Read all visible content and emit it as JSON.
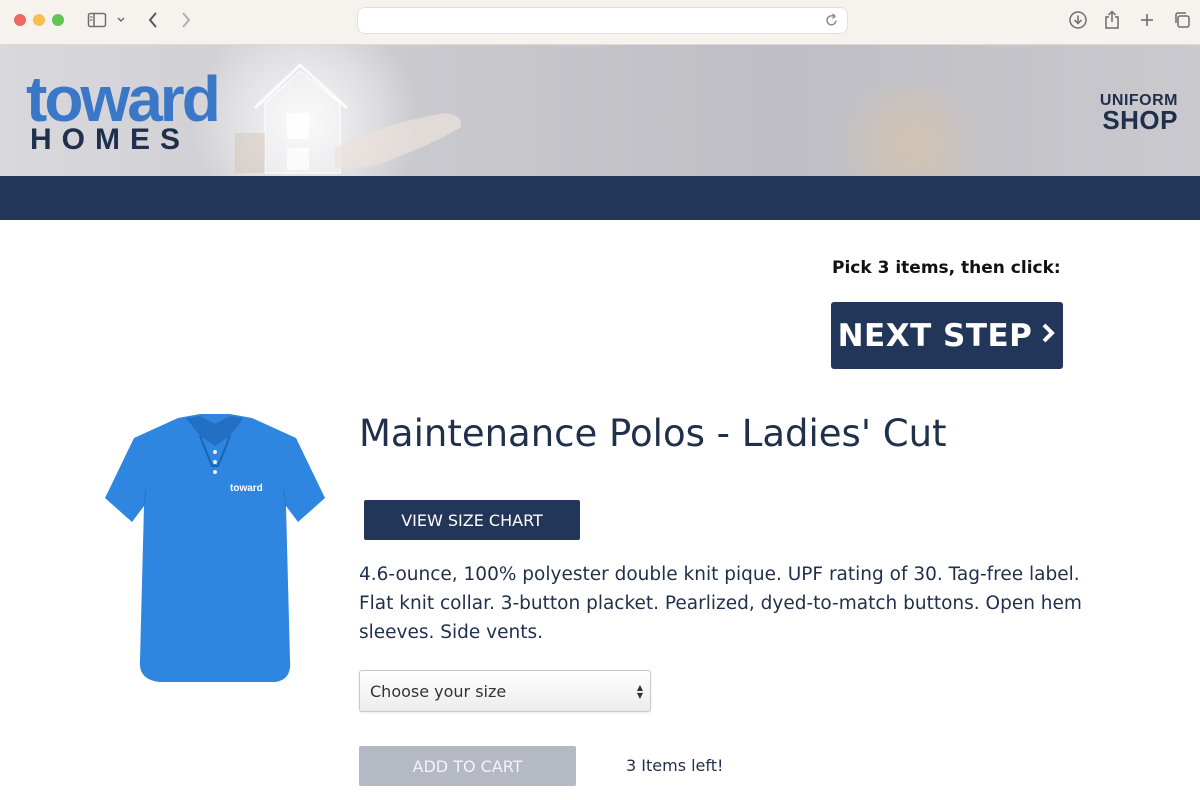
{
  "browser": {
    "toolbar_icons": [
      "sidebar-icon",
      "chevron-down-icon",
      "back-icon",
      "forward-icon",
      "reload-icon",
      "download-icon",
      "share-icon",
      "new-tab-icon",
      "tabs-overview-icon"
    ],
    "address_value": ""
  },
  "header": {
    "logo_top": "toward",
    "logo_bottom": "HOMES",
    "shop_line1": "UNIFORM",
    "shop_line2": "SHOP"
  },
  "cta": {
    "instruction": "Pick 3 items, then click:",
    "next_label": "NEXT STEP"
  },
  "product": {
    "title": "Maintenance Polos - Ladies' Cut",
    "size_chart_label": "VIEW SIZE CHART",
    "description": "4.6-ounce, 100% polyester double knit pique. UPF rating of 30. Tag-free label. Flat knit collar. 3-button placket. Pearlized, dyed-to-match buttons. Open hem sleeves. Side vents.",
    "size_select_value": "Choose your size",
    "add_to_cart_label": "ADD TO CART",
    "items_left": "3 Items left!",
    "shirt_logo_text": "toward"
  },
  "colors": {
    "navy": "#22365a",
    "logo_blue": "#3a78c7",
    "polo_blue": "#2f86e0",
    "disabled_gray": "#b4b9c4"
  }
}
